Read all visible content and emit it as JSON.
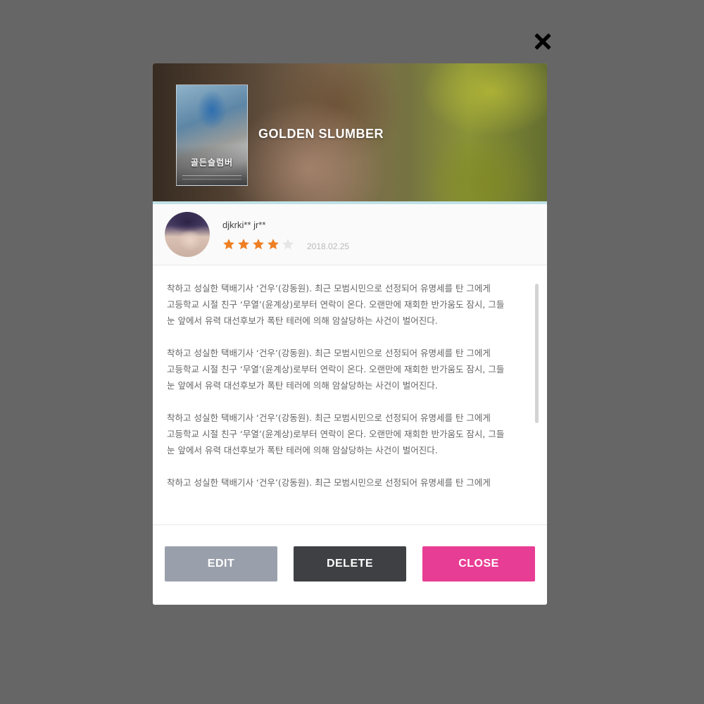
{
  "dialog": {
    "close_icon": "close-x-icon",
    "movie": {
      "title": "GOLDEN SLUMBER",
      "poster_title": "골든슬럼버"
    },
    "review": {
      "reviewer_name": "djkrki** jr**",
      "rating": 4,
      "rating_max": 5,
      "date": "2018.02.25",
      "star_color_filled": "#ee7f22",
      "star_color_empty": "#e6e6e6",
      "text": "착하고 성실한 택배기사 ‘건우’(강동원). 최근 모범시민으로 선정되어 유명세를 탄 그에게\n고등학교 시절 친구 ‘무열’(윤계상)로부터 연락이 온다. 오랜만에 재회한 반가움도 잠시, 그들\n눈 앞에서 유력 대선후보가 폭탄 테러에 의해 암살당하는 사건이 벌어진다.\n\n착하고 성실한 택배기사 ‘건우’(강동원). 최근 모범시민으로 선정되어 유명세를 탄 그에게\n고등학교 시절 친구 ‘무열’(윤계상)로부터 연락이 온다. 오랜만에 재회한 반가움도 잠시, 그들\n눈 앞에서 유력 대선후보가 폭탄 테러에 의해 암살당하는 사건이 벌어진다.\n\n착하고 성실한 택배기사 ‘건우’(강동원). 최근 모범시민으로 선정되어 유명세를 탄 그에게\n고등학교 시절 친구 ‘무열’(윤계상)로부터 연락이 온다. 오랜만에 재회한 반가움도 잠시, 그들\n눈 앞에서 유력 대선후보가 폭탄 테러에 의해 암살당하는 사건이 벌어진다.\n\n착하고 성실한 택배기사 ‘건우’(강동원). 최근 모범시민으로 선정되어 유명세를 탄 그에게"
    },
    "buttons": {
      "edit": "EDIT",
      "delete": "DELETE",
      "close": "CLOSE"
    },
    "colors": {
      "edit_button": "#9aa0ab",
      "delete_button": "#3f4044",
      "close_button": "#e83d94",
      "overlay": "#666666"
    }
  }
}
